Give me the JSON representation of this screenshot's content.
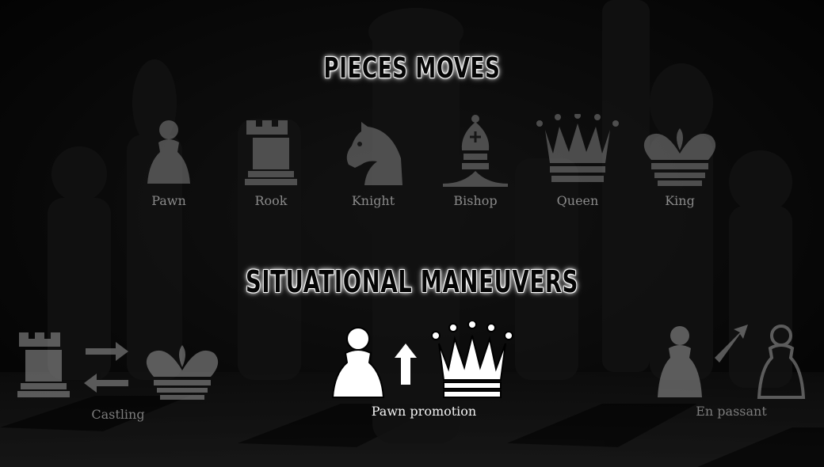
{
  "headings": {
    "pieces_moves": "PIECES MOVES",
    "situational_maneuvers": "SITUATIONAL MANEUVERS"
  },
  "pieces": [
    {
      "label": "Pawn",
      "icon": "pawn-icon"
    },
    {
      "label": "Rook",
      "icon": "rook-icon"
    },
    {
      "label": "Knight",
      "icon": "knight-icon"
    },
    {
      "label": "Bishop",
      "icon": "bishop-icon"
    },
    {
      "label": "Queen",
      "icon": "queen-icon"
    },
    {
      "label": "King",
      "icon": "king-icon"
    }
  ],
  "maneuvers": [
    {
      "label": "Castling",
      "icons": [
        "rook-icon",
        "swap-arrows-icon",
        "king-icon"
      ],
      "active": false
    },
    {
      "label": "Pawn promotion",
      "icons": [
        "pawn-icon",
        "arrow-up-icon",
        "queen-icon"
      ],
      "active": true
    },
    {
      "label": "En passant",
      "icons": [
        "pawn-icon",
        "arrow-diagonal-icon",
        "pawn-outline-icon"
      ],
      "active": false
    }
  ],
  "colors": {
    "background": "#0b0b0b",
    "inactive_icon": "#8a8a8a",
    "active_icon": "#ffffff",
    "heading_glow": "#ffffff"
  }
}
